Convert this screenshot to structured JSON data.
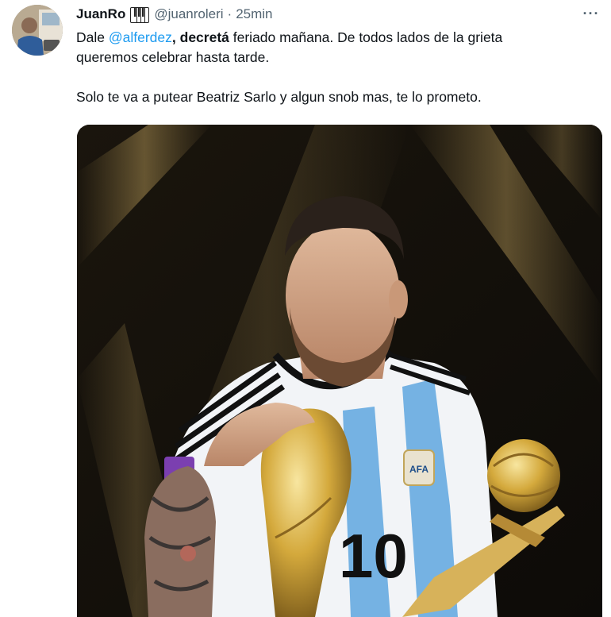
{
  "tweet": {
    "author": {
      "display_name": "JuanRo",
      "badge_icon": "piano-keys-icon",
      "handle": "@juanroleri"
    },
    "separator": "·",
    "time": "25min",
    "more_label": "···",
    "text": {
      "line1": {
        "prefix": "Dale ",
        "mention": "@alferdez",
        "comma": ", ",
        "bold": "decretá",
        "rest": " feriado mañana. De todos lados de la grieta"
      },
      "line2": "queremos celebrar hasta tarde.",
      "line3": "Solo te va a putear Beatriz Sarlo y algun snob mas, te lo prometo."
    },
    "media": {
      "jersey_number": "10",
      "crest_text": "AFA"
    }
  },
  "colors": {
    "link": "#1d9bf0",
    "secondary_text": "#536471",
    "primary_text": "#0f1419"
  }
}
